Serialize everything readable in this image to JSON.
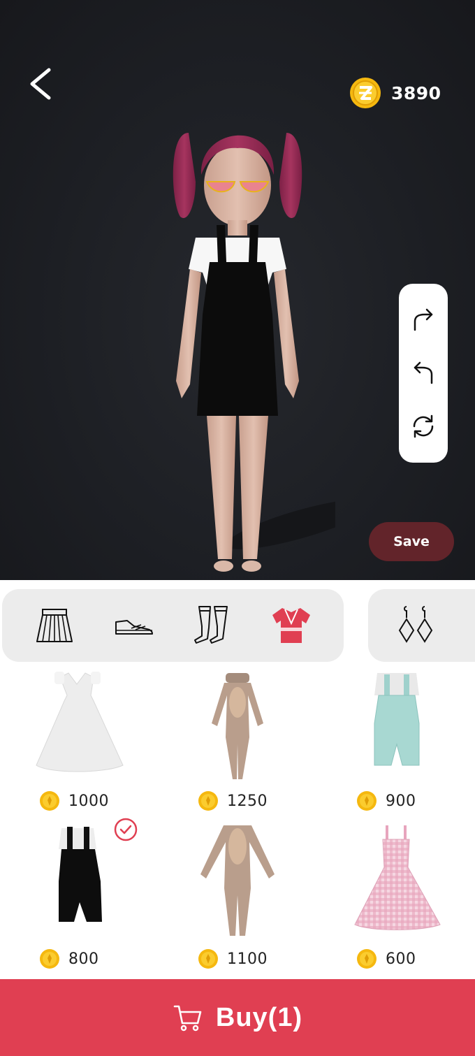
{
  "header": {
    "coins": "3890",
    "back_icon": "chevron-left-icon",
    "coin_icon": "gold-coin-icon"
  },
  "toolbar": {
    "tools": [
      {
        "name": "redo-icon"
      },
      {
        "name": "undo-icon"
      },
      {
        "name": "reset-rotate-icon"
      }
    ],
    "save_label": "Save"
  },
  "categories": [
    {
      "name": "skirt-icon",
      "active": false
    },
    {
      "name": "sneaker-icon",
      "active": false
    },
    {
      "name": "stockings-icon",
      "active": false
    },
    {
      "name": "top-outfit-icon",
      "active": true
    },
    {
      "name": "earrings-icon",
      "active": false
    }
  ],
  "items": [
    {
      "name": "white-dress",
      "price": "1000",
      "selected": false
    },
    {
      "name": "bodysuit-short-sleeve",
      "price": "1250",
      "selected": false
    },
    {
      "name": "mint-overalls",
      "price": "900",
      "selected": false
    },
    {
      "name": "black-overalls",
      "price": "800",
      "selected": true
    },
    {
      "name": "bodysuit-long-sleeve",
      "price": "1100",
      "selected": false
    },
    {
      "name": "pink-gingham-dress",
      "price": "600",
      "selected": false
    }
  ],
  "buy": {
    "label": "Buy(1)",
    "icon": "cart-icon"
  },
  "colors": {
    "accent": "#e03f52",
    "save": "#62242a",
    "stage": "#1d1f24",
    "coin": "#f2b411"
  }
}
